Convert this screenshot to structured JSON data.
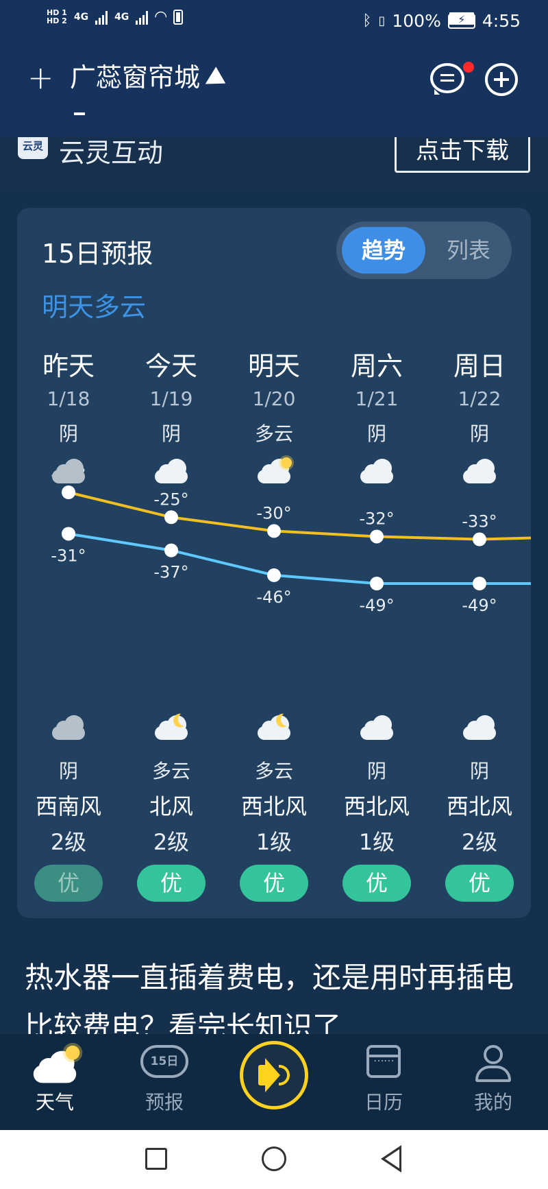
{
  "status_bar": {
    "hd1": "HD 1",
    "hd2": "HD 2",
    "net1": "4G",
    "net2": "4G",
    "battery": "100%",
    "time": "4:55"
  },
  "header": {
    "city": "广蕊窗帘城"
  },
  "ad": {
    "logo_text": "云灵",
    "name": "云灵互动",
    "button": "点击下载"
  },
  "forecast": {
    "title": "15日预报",
    "subtitle": "明天多云",
    "tabs": [
      "趋势",
      "列表"
    ],
    "days": [
      {
        "name": "昨天",
        "date": "1/18",
        "day_cond": "阴",
        "day_icon": "cloud-icon",
        "high": -16,
        "low": -31,
        "night_cond": "阴",
        "night_icon": "cloud-icon",
        "wind_dir": "西南风",
        "wind_lvl": "2级",
        "aqi": "优",
        "past": true
      },
      {
        "name": "今天",
        "date": "1/19",
        "day_cond": "阴",
        "day_icon": "cloud-icon",
        "high": -25,
        "low": -37,
        "night_cond": "多云",
        "night_icon": "cloudy-night-icon",
        "wind_dir": "北风",
        "wind_lvl": "2级",
        "aqi": "优",
        "past": false
      },
      {
        "name": "明天",
        "date": "1/20",
        "day_cond": "多云",
        "day_icon": "partly-cloudy-icon",
        "high": -30,
        "low": -46,
        "night_cond": "多云",
        "night_icon": "cloudy-night-icon",
        "wind_dir": "西北风",
        "wind_lvl": "1级",
        "aqi": "优",
        "past": false
      },
      {
        "name": "周六",
        "date": "1/21",
        "day_cond": "阴",
        "day_icon": "cloud-icon",
        "high": -32,
        "low": -49,
        "night_cond": "阴",
        "night_icon": "cloud-icon",
        "wind_dir": "西北风",
        "wind_lvl": "1级",
        "aqi": "优",
        "past": false
      },
      {
        "name": "周日",
        "date": "1/22",
        "day_cond": "阴",
        "day_icon": "cloud-icon",
        "high": -33,
        "low": -49,
        "night_cond": "阴",
        "night_icon": "cloud-icon",
        "wind_dir": "西北风",
        "wind_lvl": "2级",
        "aqi": "优",
        "past": false
      }
    ]
  },
  "chart_data": {
    "type": "line",
    "categories": [
      "1/18",
      "1/19",
      "1/20",
      "1/21",
      "1/22"
    ],
    "series": [
      {
        "values": [
          -16,
          -25,
          -30,
          -32,
          -33
        ],
        "color": "#f0c020"
      },
      {
        "values": [
          -31,
          -37,
          -46,
          -49,
          -49
        ],
        "color": "#5ec8ff"
      }
    ],
    "point_label_suffix": "°"
  },
  "article": {
    "text": "热水器一直插着费电，还是用时再插电比较费电？看完长知识了"
  },
  "nav": {
    "items": [
      {
        "label": "天气",
        "icon": "weather-icon",
        "active": true
      },
      {
        "label": "预报",
        "icon": "forecast-15-icon",
        "icon_text": "15日",
        "active": false
      },
      {
        "label": "",
        "icon": "speaker-icon",
        "active": false
      },
      {
        "label": "日历",
        "icon": "calendar-icon",
        "active": false
      },
      {
        "label": "我的",
        "icon": "user-icon",
        "active": false
      }
    ]
  },
  "colors": {
    "accent": "#3e8ee7",
    "aqi_good": "#34c49b",
    "high_line": "#f0c020",
    "low_line": "#5ec8ff"
  }
}
